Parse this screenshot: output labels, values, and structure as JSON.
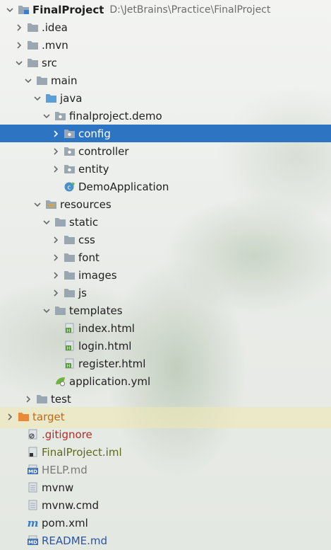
{
  "project": {
    "name": "FinalProject",
    "path": "D:\\JetBrains\\Practice\\FinalProject"
  },
  "rows": [
    {
      "label": "FinalProject",
      "depth": 0,
      "arrow": "down",
      "icon": "module-folder-icon"
    },
    {
      "label": ".idea",
      "depth": 1,
      "arrow": "right",
      "icon": "folder-icon"
    },
    {
      "label": ".mvn",
      "depth": 1,
      "arrow": "right",
      "icon": "folder-icon"
    },
    {
      "label": "src",
      "depth": 1,
      "arrow": "down",
      "icon": "folder-icon"
    },
    {
      "label": "main",
      "depth": 2,
      "arrow": "down",
      "icon": "folder-icon"
    },
    {
      "label": "java",
      "depth": 3,
      "arrow": "down",
      "icon": "source-folder-icon"
    },
    {
      "label": "finalproject.demo",
      "depth": 4,
      "arrow": "down",
      "icon": "package-icon"
    },
    {
      "label": "config",
      "depth": 5,
      "arrow": "right",
      "icon": "package-icon",
      "selected": true
    },
    {
      "label": "controller",
      "depth": 5,
      "arrow": "right",
      "icon": "package-icon"
    },
    {
      "label": "entity",
      "depth": 5,
      "arrow": "right",
      "icon": "package-icon"
    },
    {
      "label": "DemoApplication",
      "depth": 5,
      "arrow": "none",
      "icon": "spring-class-icon"
    },
    {
      "label": "resources",
      "depth": 3,
      "arrow": "down",
      "icon": "resources-folder-icon"
    },
    {
      "label": "static",
      "depth": 4,
      "arrow": "down",
      "icon": "folder-icon"
    },
    {
      "label": "css",
      "depth": 5,
      "arrow": "right",
      "icon": "folder-icon"
    },
    {
      "label": "font",
      "depth": 5,
      "arrow": "right",
      "icon": "folder-icon"
    },
    {
      "label": "images",
      "depth": 5,
      "arrow": "right",
      "icon": "folder-icon"
    },
    {
      "label": "js",
      "depth": 5,
      "arrow": "right",
      "icon": "folder-icon"
    },
    {
      "label": "templates",
      "depth": 4,
      "arrow": "down",
      "icon": "folder-icon"
    },
    {
      "label": "index.html",
      "depth": 5,
      "arrow": "none",
      "icon": "html-file-icon"
    },
    {
      "label": "login.html",
      "depth": 5,
      "arrow": "none",
      "icon": "html-file-icon"
    },
    {
      "label": "register.html",
      "depth": 5,
      "arrow": "none",
      "icon": "html-file-icon"
    },
    {
      "label": "application.yml",
      "depth": 4,
      "arrow": "none",
      "icon": "spring-config-icon"
    },
    {
      "label": "test",
      "depth": 2,
      "arrow": "right",
      "icon": "folder-icon"
    },
    {
      "label": "target",
      "depth": 0,
      "arrow": "right",
      "icon": "excluded-folder-icon",
      "color": "orange"
    },
    {
      "label": ".gitignore",
      "depth": 1,
      "arrow": "none",
      "icon": "ignore-file-icon",
      "color": "red"
    },
    {
      "label": "FinalProject.iml",
      "depth": 1,
      "arrow": "none",
      "icon": "iml-file-icon",
      "color": "olive"
    },
    {
      "label": "HELP.md",
      "depth": 1,
      "arrow": "none",
      "icon": "markdown-file-icon",
      "color": "gray"
    },
    {
      "label": "mvnw",
      "depth": 1,
      "arrow": "none",
      "icon": "text-file-icon"
    },
    {
      "label": "mvnw.cmd",
      "depth": 1,
      "arrow": "none",
      "icon": "text-file-icon"
    },
    {
      "label": "pom.xml",
      "depth": 1,
      "arrow": "none",
      "icon": "maven-file-icon"
    },
    {
      "label": "README.md",
      "depth": 1,
      "arrow": "none",
      "icon": "markdown-file-icon",
      "color": "blue"
    }
  ],
  "colors": {
    "selection": "#2d75c3",
    "folder": "#9aa7b0",
    "source_folder": "#5aa0d8",
    "excluded_folder": "#e88a3a",
    "target_text": "#bd6a1e",
    "gitignore_text": "#b22d24",
    "iml_text": "#5e6a1a",
    "readme_text": "#2a55a6",
    "help_text": "#7a7a7a"
  }
}
